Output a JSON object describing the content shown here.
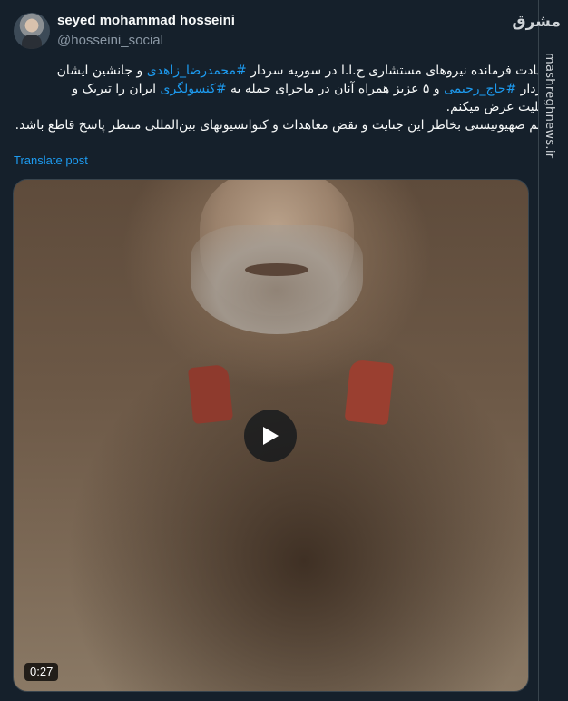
{
  "author": {
    "display_name": "seyed mohammad hosseini",
    "handle": "@hosseini_social"
  },
  "tweet": {
    "line1_a": "شهادت فرمانده نیروهای مستشاری ج.ا.ا در سوریه سردار ",
    "line1_tag": "#محمدرضا_زاهدی",
    "line1_b": " و جانشین ایشان",
    "line2_a": "سردار ",
    "line2_tag1": "#حاج_رحیمی",
    "line2_b": " و ۵ عزیز همراه آنان در ماجرای حمله به ",
    "line2_tag2": "#کنسولگری",
    "line2_c": " ایران را تبریک و",
    "line3": "تسلیت عرض میکنم.",
    "line4": "رژیم صهیونیستی بخاطر این جنایت و نقض معاهدات و کنوانسیونهای بین‌المللی منتظر پاسخ قاطع باشد."
  },
  "translate_label": "Translate post",
  "media": {
    "duration": "0:27"
  },
  "watermark": {
    "logo": "مشرق",
    "site": "mashreghnews.ir"
  },
  "colors": {
    "background": "#15202b",
    "link": "#1d9bf0",
    "muted": "#8b98a5"
  },
  "icons": {
    "play": "play-icon"
  }
}
